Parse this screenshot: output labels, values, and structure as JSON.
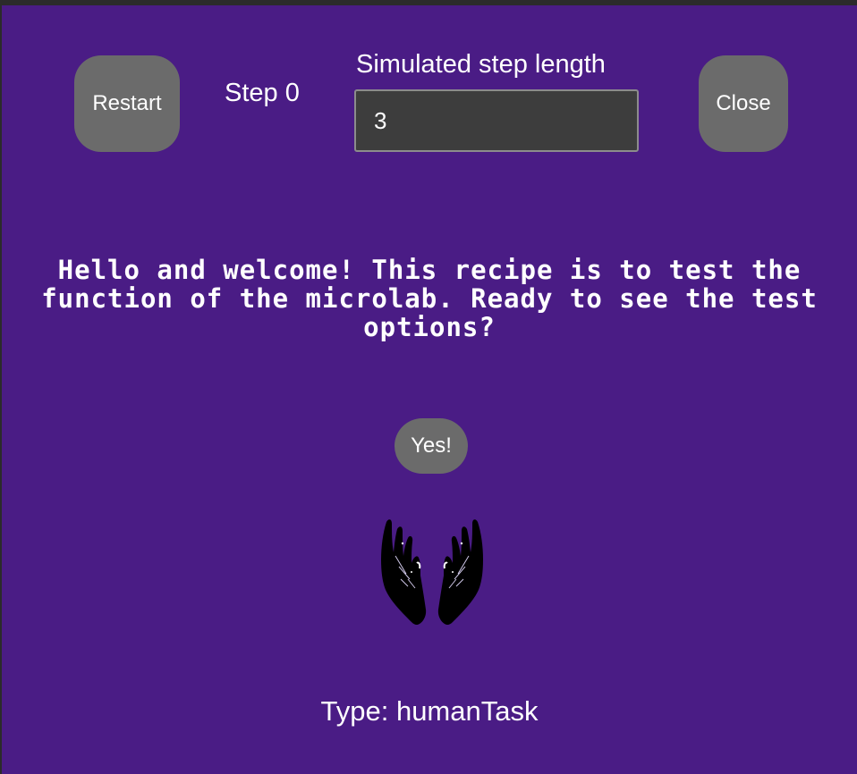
{
  "toolbar": {
    "restart_label": "Restart",
    "step_label": "Step 0",
    "step_length_label": "Simulated step length",
    "step_length_value": "3",
    "close_label": "Close"
  },
  "main": {
    "message": "Hello and welcome! This recipe is to test the function of the microlab. Ready to see the test options?",
    "yes_label": "Yes!",
    "image_icon": "hands-icon",
    "type_label": "Type: humanTask"
  },
  "colors": {
    "background": "#4a1c85",
    "button": "#6b6b6b",
    "input_background": "#3d3d3d",
    "text": "#ffffff"
  }
}
